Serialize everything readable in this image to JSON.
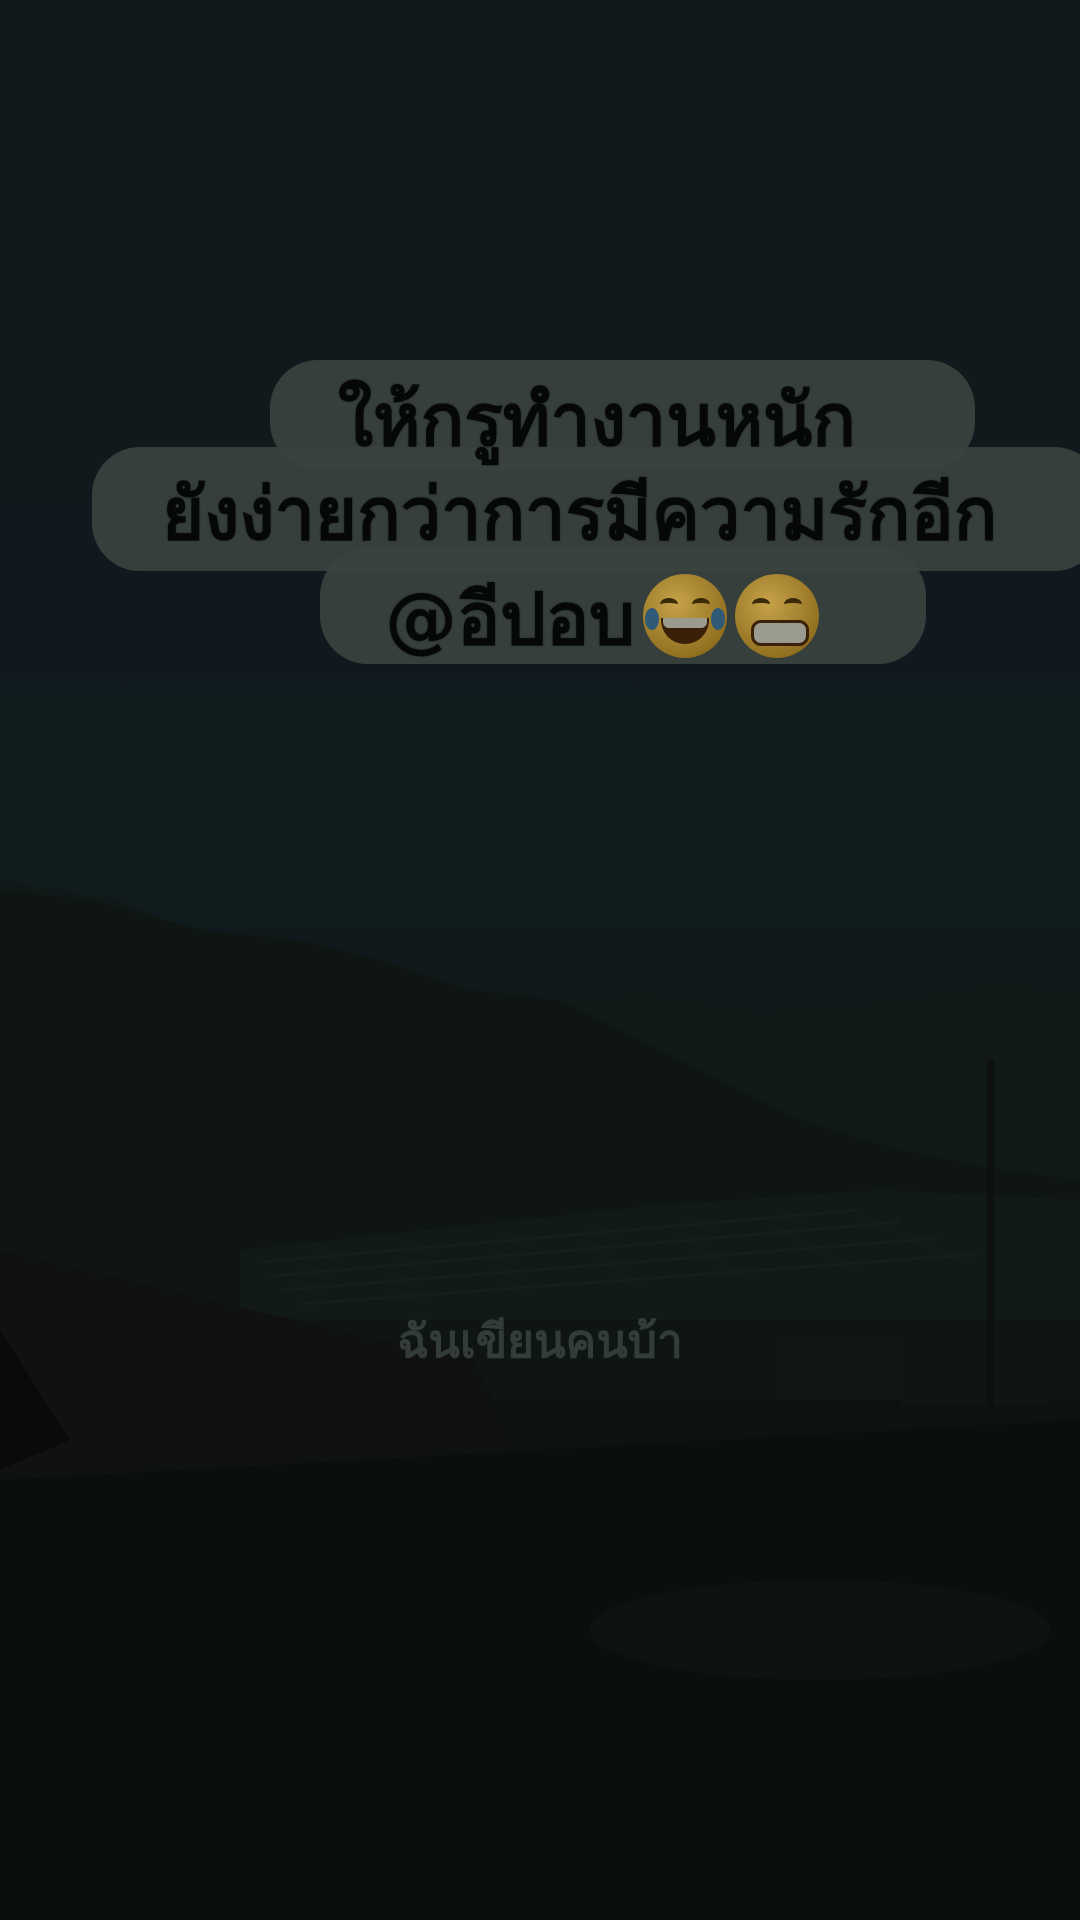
{
  "caption": {
    "line1": "ให้กรูทำงานหนัก",
    "line2": "ยังง่ายกว่าการมีความรักอีก",
    "line3": "@อีปอบ",
    "emoji_1": "face-with-tears-of-joy",
    "emoji_2": "grinning-face"
  },
  "watermark": "ฉันเขียนคนบ้า",
  "colors": {
    "pill": "#3a423e",
    "text": "#050807",
    "sky": "#1b2c31",
    "ground": "#111b17"
  }
}
